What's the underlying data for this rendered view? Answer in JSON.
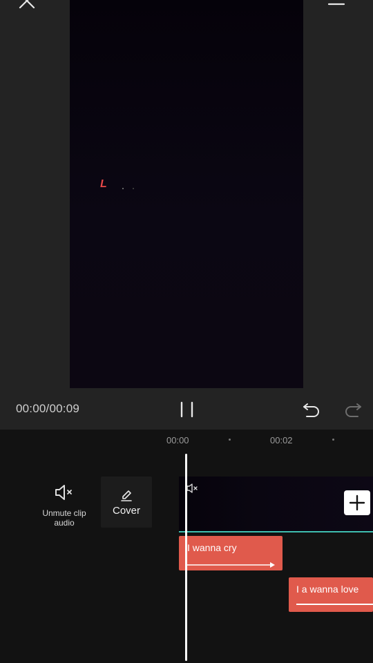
{
  "player": {
    "timecode": "00:00/00:09",
    "preview_glyph": "L"
  },
  "timeline": {
    "ruler": [
      {
        "label": "00:00"
      },
      {
        "label": "00:02"
      }
    ],
    "tools": {
      "unmute_label": "Unmute clip audio",
      "cover_label": "Cover"
    },
    "text_clips": [
      {
        "label": "I wanna cry"
      },
      {
        "label": "I a wanna love"
      }
    ]
  },
  "colors": {
    "background": "#232323",
    "timeline_bg": "#121212",
    "text_clip": "#e05a4c",
    "track_line": "#3fbfb0",
    "playhead": "#ffffff"
  },
  "icons": [
    "close-icon",
    "fullscreen-icon",
    "menu-icon",
    "pause-icon",
    "undo-icon",
    "redo-icon",
    "speaker-mute-icon",
    "edit-pencil-icon",
    "plus-icon"
  ]
}
